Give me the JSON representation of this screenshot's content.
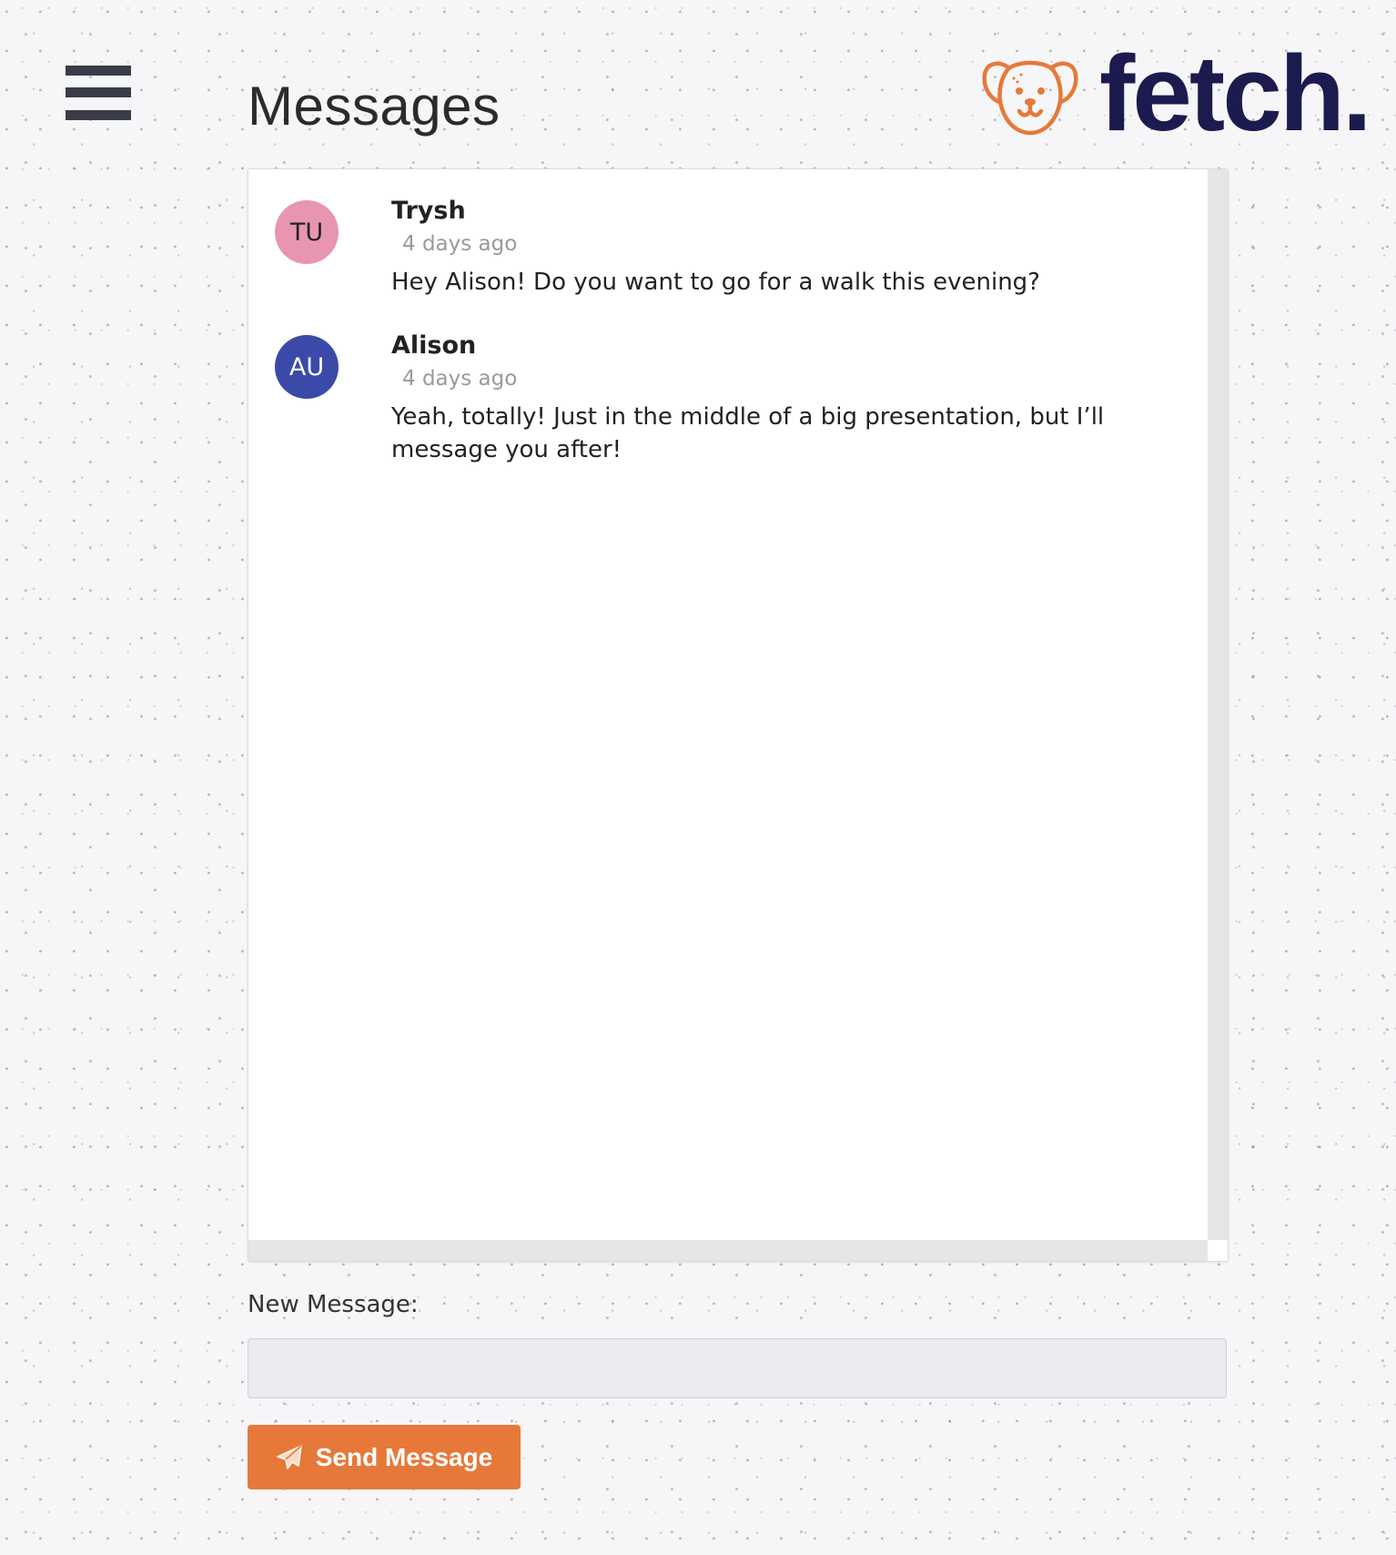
{
  "header": {
    "menu_icon": "hamburger-menu-icon",
    "title": "Messages",
    "brand": {
      "name": "fetch.",
      "logo_icon": "dog-face-icon",
      "logo_color": "#e6793a",
      "name_color": "#1b1b4f"
    }
  },
  "messages": [
    {
      "initials": "TU",
      "avatar_color": "#e896b0",
      "avatar_text_color": "#222222",
      "sender": "Trysh",
      "time": "4 days ago",
      "text": "Hey Alison! Do you want to go for a walk this evening?"
    },
    {
      "initials": "AU",
      "avatar_color": "#3b4aa8",
      "avatar_text_color": "#ffffff",
      "sender": "Alison",
      "time": "4 days ago",
      "text": "Yeah, totally! Just in the middle of a big presentation, but I’ll message you after!"
    }
  ],
  "composer": {
    "label": "New Message:",
    "value": "",
    "placeholder": "",
    "send_label": "Send Message",
    "send_icon": "paper-plane-icon",
    "button_color": "#e6793a"
  }
}
